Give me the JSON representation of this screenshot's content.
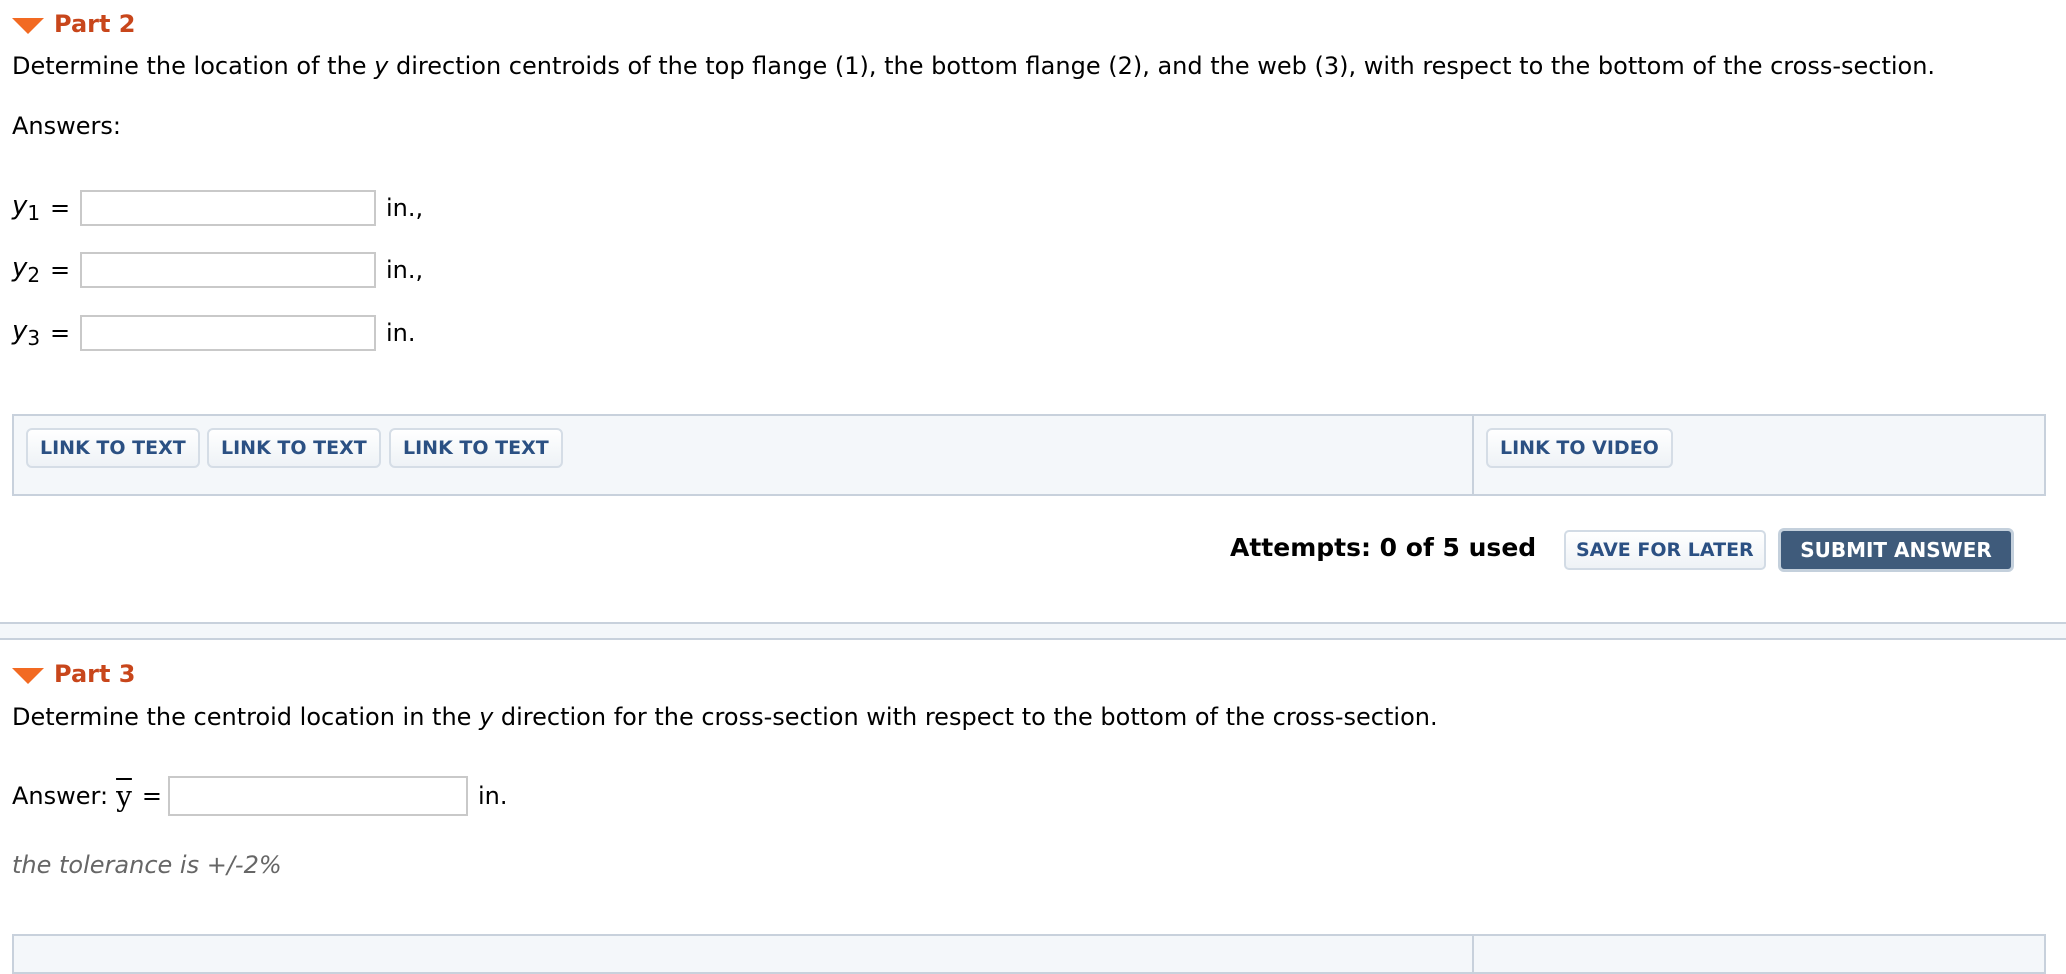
{
  "part2": {
    "title": "Part 2",
    "question_pre": "Determine the location of the ",
    "question_var": "y",
    "question_post": " direction centroids of the top flange (1), the bottom flange (2), and the web (3), with respect to the bottom of the cross-section.",
    "answers_label": "Answers:",
    "rows": [
      {
        "var": "y",
        "sub": "1",
        "eq": "=",
        "value": "",
        "unit": "in.,"
      },
      {
        "var": "y",
        "sub": "2",
        "eq": "=",
        "value": "",
        "unit": "in.,"
      },
      {
        "var": "y",
        "sub": "3",
        "eq": "=",
        "value": "",
        "unit": "in."
      }
    ],
    "links": [
      "LINK TO TEXT",
      "LINK TO TEXT",
      "LINK TO TEXT"
    ],
    "video_link": "LINK TO VIDEO",
    "attempts": "Attempts: 0 of 5 used",
    "save_label": "SAVE FOR LATER",
    "submit_label": "SUBMIT ANSWER"
  },
  "part3": {
    "title": "Part 3",
    "question_pre": "Determine the centroid location in the ",
    "question_var": "y",
    "question_post": " direction for the cross-section with respect to the bottom of the cross-section.",
    "answer_label": "Answer:",
    "answer_var": "y",
    "eq": "=",
    "value": "",
    "unit": "in.",
    "tolerance": "the tolerance is +/-2%"
  },
  "colors": {
    "part_title": "#c8461b",
    "triangle": "#f26a22",
    "link_text": "#2b5083",
    "submit_bg": "#3f5b7b",
    "panel_bg": "#f4f7fa",
    "panel_border": "#c8d1dc"
  }
}
